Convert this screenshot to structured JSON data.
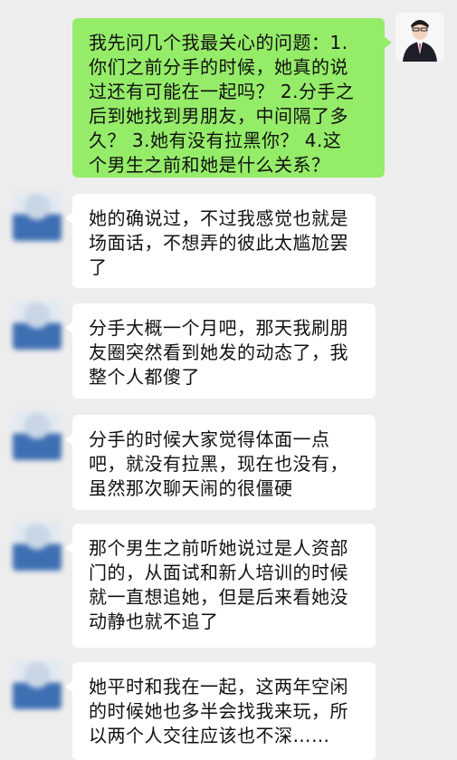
{
  "messages": [
    {
      "sender": "self",
      "text": "我先问几个我最关心的问题：1.\n你们之前分手的时候，她真的说\n过还有可能在一起吗？ 2.分手之\n后到她找到男朋友，中间隔了多\n久？ 3.她有没有拉黑你？ 4.这\n个男生之前和她是什么关系？"
    },
    {
      "sender": "other",
      "text": "她的确说过，不过我感觉也就是\n场面话，不想弄的彼此太尴尬罢\n了"
    },
    {
      "sender": "other",
      "text": "分手大概一个月吧，那天我刷朋\n友圈突然看到她发的动态了，我\n整个人都傻了"
    },
    {
      "sender": "other",
      "text": "分手的时候大家觉得体面一点\n吧，就没有拉黑，现在也没有，\n虽然那次聊天闹的很僵硬"
    },
    {
      "sender": "other",
      "text": "那个男生之前听她说过是人资部\n门的，从面试和新人培训的时候\n就一直想追她，但是后来看她没\n动静也就不追了"
    },
    {
      "sender": "other",
      "text": "她平时和我在一起，这两年空闲\n的时候她也多半会找我来玩，所\n以两个人交往应该也不深……"
    }
  ]
}
